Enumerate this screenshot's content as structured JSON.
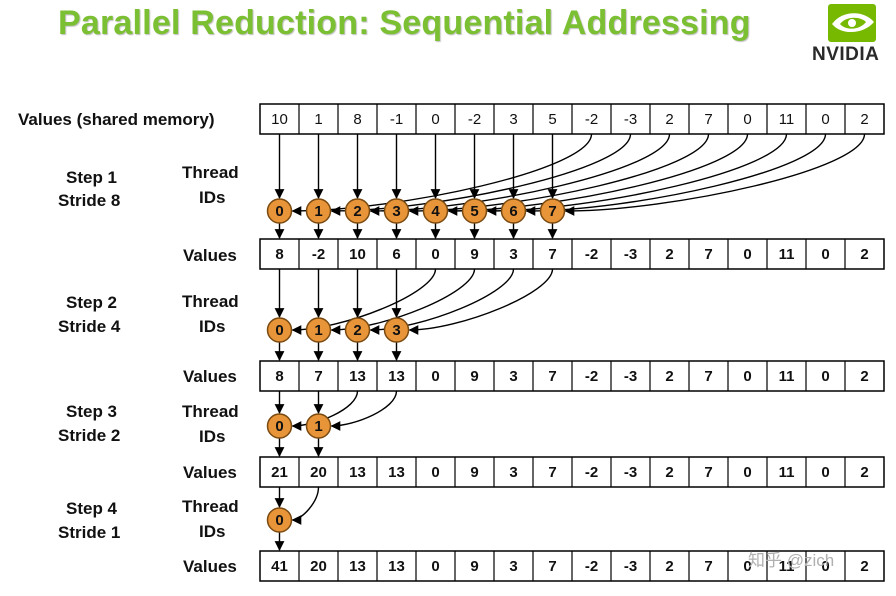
{
  "title": "Parallel Reduction: Sequential Addressing",
  "brand": {
    "name": "NVIDIA",
    "color": "#76b900"
  },
  "labels": {
    "values_shared": "Values (shared memory)",
    "values": "Values",
    "thread_ids": [
      "Thread",
      "IDs"
    ]
  },
  "rows": [
    {
      "values": [
        "10",
        "1",
        "8",
        "-1",
        "0",
        "-2",
        "3",
        "5",
        "-2",
        "-3",
        "2",
        "7",
        "0",
        "11",
        "0",
        "2"
      ]
    },
    {
      "values": [
        "8",
        "-2",
        "10",
        "6",
        "0",
        "9",
        "3",
        "7",
        "-2",
        "-3",
        "2",
        "7",
        "0",
        "11",
        "0",
        "2"
      ]
    },
    {
      "values": [
        "8",
        "7",
        "13",
        "13",
        "0",
        "9",
        "3",
        "7",
        "-2",
        "-3",
        "2",
        "7",
        "0",
        "11",
        "0",
        "2"
      ]
    },
    {
      "values": [
        "21",
        "20",
        "13",
        "13",
        "0",
        "9",
        "3",
        "7",
        "-2",
        "-3",
        "2",
        "7",
        "0",
        "11",
        "0",
        "2"
      ]
    },
    {
      "values": [
        "41",
        "20",
        "13",
        "13",
        "0",
        "9",
        "3",
        "7",
        "-2",
        "-3",
        "2",
        "7",
        "0",
        "11",
        "0",
        "2"
      ]
    }
  ],
  "steps": [
    {
      "step": "Step 1",
      "stride_label": "Stride 8",
      "stride": 8,
      "thread_ids": [
        "0",
        "1",
        "2",
        "3",
        "4",
        "5",
        "6",
        "7"
      ]
    },
    {
      "step": "Step 2",
      "stride_label": "Stride 4",
      "stride": 4,
      "thread_ids": [
        "0",
        "1",
        "2",
        "3"
      ]
    },
    {
      "step": "Step 3",
      "stride_label": "Stride 2",
      "stride": 2,
      "thread_ids": [
        "0",
        "1"
      ]
    },
    {
      "step": "Step 4",
      "stride_label": "Stride 1",
      "stride": 1,
      "thread_ids": [
        "0"
      ]
    }
  ],
  "watermark": "知乎 @zich",
  "colors": {
    "title": "#7bbf32",
    "thread_fill": "#e8953a",
    "thread_stroke": "#7a4a10"
  }
}
